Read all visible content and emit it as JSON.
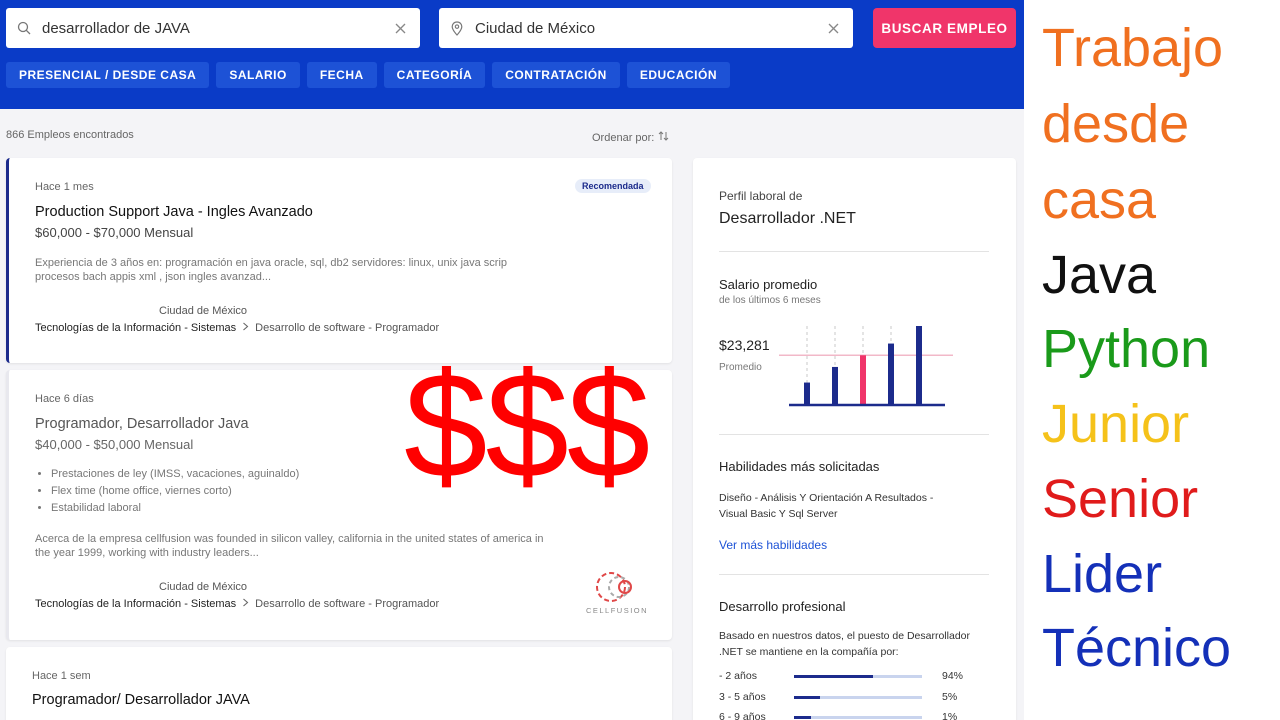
{
  "search": {
    "keyword": "desarrollador de JAVA",
    "location": "Ciudad de México",
    "button_label": "BUSCAR EMPLEO"
  },
  "filters": [
    "PRESENCIAL / DESDE CASA",
    "SALARIO",
    "FECHA",
    "CATEGORÍA",
    "CONTRATACIÓN",
    "EDUCACIÓN"
  ],
  "results": {
    "count_text": "866 Empleos encontrados",
    "sort_label": "Ordenar por:"
  },
  "jobs": [
    {
      "posted": "Hace 1 mes",
      "badge": "Recomendada",
      "title": "Production Support Java - Ingles Avanzado",
      "salary": "$60,000 - $70,000 Mensual",
      "desc_1": "Experiencia de 3 años en: programación en java oracle, sql, db2 servidores: linux, unix java scrip",
      "desc_2": "procesos bach appis xml , json ingles avanzad...",
      "city": "Ciudad de México",
      "category": "Tecnologías de la Información - Sistemas",
      "subcategory": "Desarrollo de software - Programador"
    },
    {
      "posted": "Hace 6 días",
      "title": "Programador, Desarrollador Java",
      "salary": "$40,000 - $50,000 Mensual",
      "benefits": [
        "Prestaciones de ley (IMSS, vacaciones, aguinaldo)",
        "Flex time (home office, viernes corto)",
        "Estabilidad laboral"
      ],
      "desc_1": "Acerca de la empresa cellfusion was founded in silicon valley, california in the united states of america in",
      "desc_2": "the year 1999, working with industry leaders...",
      "city": "Ciudad de México",
      "category": "Tecnologías de la Información - Sistemas",
      "subcategory": "Desarrollo de software - Programador",
      "logo_text": "CELLFUSION"
    },
    {
      "posted": "Hace 1 sem",
      "title": "Programador/ Desarrollador JAVA"
    }
  ],
  "dollar_overlay": "$$$",
  "panel": {
    "profile_label": "Perfil laboral de",
    "profile_title": "Desarrollador .NET",
    "salary_heading": "Salario promedio",
    "salary_sub": "de los últimos 6 meses",
    "salary_value": "$23,281",
    "salary_caption": "Promedio",
    "skills_heading": "Habilidades más solicitadas",
    "skills_line_1": "Diseño  -  Análisis Y Orientación A Resultados  -",
    "skills_line_2": "Visual Basic Y Sql Server",
    "skills_link": "Ver más habilidades",
    "dev_heading": "Desarrollo profesional",
    "dev_text_1": "Basado en nuestros datos, el puesto de Desarrollador",
    "dev_text_2": ".NET se mantiene en la compañía por:",
    "tenure": [
      {
        "label": "- 2 años",
        "pct": "94%",
        "value": 0.62
      },
      {
        "label": "3 - 5 años",
        "pct": "5%",
        "value": 0.2
      },
      {
        "label": "6 - 9 años",
        "pct": "1%",
        "value": 0.13
      }
    ]
  },
  "chart_data": {
    "type": "bar",
    "values": [
      22,
      38,
      50,
      62,
      80
    ],
    "highlight_index": 2,
    "average_label": "$23,281",
    "colors": {
      "bar": "#1c2b8c",
      "highlight": "#f0356a",
      "avg_line": "#f2b8c8",
      "grid": "#c9c9c9"
    }
  },
  "overlay": {
    "words": [
      {
        "text": "Trabajo",
        "color": "#f07020"
      },
      {
        "text": "desde",
        "color": "#f07020"
      },
      {
        "text": "casa",
        "color": "#f07020"
      },
      {
        "text": "Java",
        "color": "#111111"
      },
      {
        "text": "Python",
        "color": "#1a9a1a"
      },
      {
        "text": "Junior",
        "color": "#f5c21a"
      },
      {
        "text": "Senior",
        "color": "#e01b1b"
      },
      {
        "text": "Lider",
        "color": "#1430b8"
      },
      {
        "text": "Técnico",
        "color": "#1430b8"
      }
    ]
  },
  "colors": {
    "brand_blue": "#0a3bc7",
    "filter_blue": "#1d52d6",
    "cta_pink": "#f0356a",
    "navy": "#1c2b8c",
    "dollar_red": "#ff0000"
  }
}
